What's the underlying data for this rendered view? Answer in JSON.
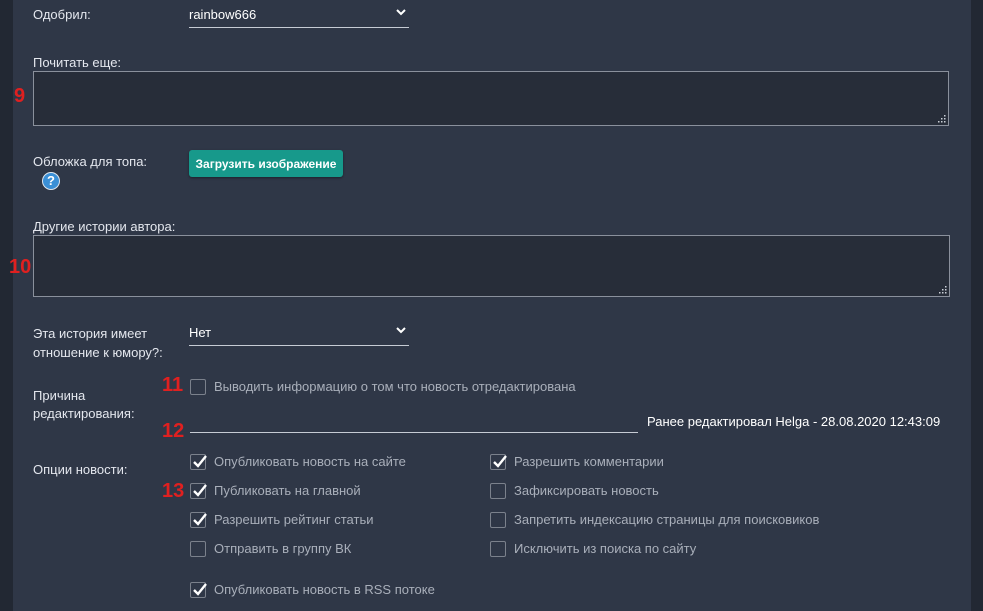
{
  "approved": {
    "label": "Одобрил:",
    "value": "rainbow666"
  },
  "read_more": {
    "label": "Почитать еще:",
    "marker": "9",
    "value": ""
  },
  "cover": {
    "label": "Обложка для топа:",
    "button_label": "Загрузить изображение",
    "help_icon": "?"
  },
  "other_stories": {
    "label": "Другие истории автора:",
    "marker": "10",
    "value": ""
  },
  "humor": {
    "label_line1": "Эта история имеет",
    "label_line2": "отношение к юмору?:",
    "value": "Нет"
  },
  "edit_reason": {
    "label_line1": "Причина",
    "label_line2": "редактирования:",
    "marker_checkbox": "11",
    "checkbox_label": "Выводить информацию о том что новость отредактирована",
    "checkbox_checked": false,
    "marker_input": "12",
    "input_value": "",
    "last_edited": "Ранее редактировал Helga - 28.08.2020 12:43:09"
  },
  "options": {
    "label": "Опции новости:",
    "marker": "13",
    "left": [
      {
        "label": "Опубликовать новость на сайте",
        "checked": true
      },
      {
        "label": "Публиковать на главной",
        "checked": true
      },
      {
        "label": "Разрешить рейтинг статьи",
        "checked": true
      },
      {
        "label": "Отправить в группу ВК",
        "checked": false
      }
    ],
    "right": [
      {
        "label": "Разрешить комментарии",
        "checked": true
      },
      {
        "label": "Зафиксировать новость",
        "checked": false
      },
      {
        "label": "Запретить индексацию страницы для поисковиков",
        "checked": false
      },
      {
        "label": "Исключить из поиска по сайту",
        "checked": false
      }
    ],
    "rss": {
      "label": "Опубликовать новость в RSS потоке",
      "checked": true
    }
  },
  "colors": {
    "panel": "#2f3747",
    "accent_button": "#17998b",
    "marker": "#e02020",
    "help": "#3a8fd6"
  }
}
